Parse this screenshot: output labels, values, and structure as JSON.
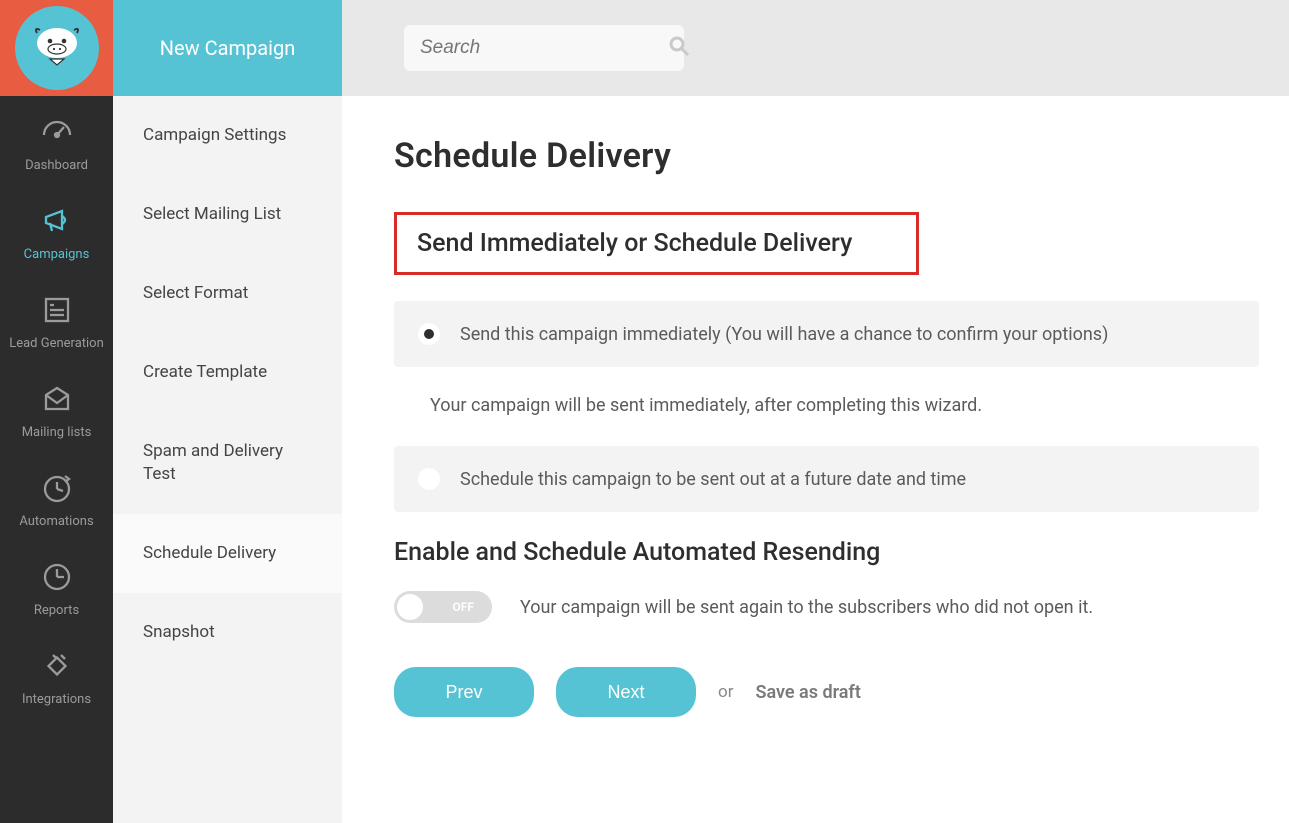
{
  "rail": {
    "items": [
      {
        "label": "Dashboard"
      },
      {
        "label": "Campaigns"
      },
      {
        "label": "Lead Generation"
      },
      {
        "label": "Mailing lists"
      },
      {
        "label": "Automations"
      },
      {
        "label": "Reports"
      },
      {
        "label": "Integrations"
      }
    ],
    "active_index": 1
  },
  "sidebar": {
    "header": "New Campaign",
    "items": [
      {
        "label": "Campaign Settings"
      },
      {
        "label": "Select Mailing List"
      },
      {
        "label": "Select Format"
      },
      {
        "label": "Create Template"
      },
      {
        "label": "Spam and Delivery Test"
      },
      {
        "label": "Schedule Delivery"
      },
      {
        "label": "Snapshot"
      }
    ],
    "active_index": 5
  },
  "search": {
    "placeholder": "Search"
  },
  "page": {
    "title": "Schedule Delivery",
    "send_section_title": "Send Immediately or Schedule Delivery",
    "option_immediate_label": "Send this campaign immediately (You will have a chance to confirm your options)",
    "option_immediate_helper": "Your campaign will be sent immediately, after completing this wizard.",
    "option_schedule_label": "Schedule this campaign to be sent out at a future date and time",
    "selected_option": "immediate",
    "resend_section_title": "Enable and Schedule Automated Resending",
    "resend_toggle": {
      "state": "off",
      "label": "OFF"
    },
    "resend_helper": "Your campaign will be sent again to the subscribers who did not open it.",
    "highlight_color": "#d92a2a"
  },
  "footer": {
    "prev_label": "Prev",
    "next_label": "Next",
    "or_label": "or",
    "save_draft_label": "Save as draft"
  },
  "colors": {
    "accent": "#55c3d4",
    "logo_bg": "#e85c41"
  }
}
